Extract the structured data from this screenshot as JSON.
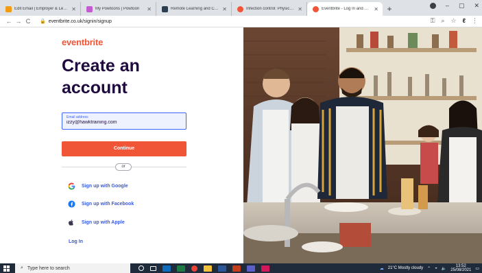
{
  "browser": {
    "tabs": [
      {
        "title": "Edit Email | Employer & Learner",
        "favicon_color": "#f39c12",
        "active": false
      },
      {
        "title": "My Powtoons | Powtoon",
        "favicon_color": "#c55bd1",
        "active": false
      },
      {
        "title": "Remote Learning and Communi",
        "favicon_color": "#2c3e50",
        "active": false
      },
      {
        "title": "Infection control: Physical care o",
        "favicon_color": "#f05537",
        "active": false
      },
      {
        "title": "Eventbrite - Log In and Sign In",
        "favicon_color": "#f05537",
        "active": true
      }
    ],
    "new_tab": "+",
    "url": "eventbrite.co.uk/signin/signup",
    "window_controls": {
      "minimize": "–",
      "maximize": "▢",
      "close": "✕"
    }
  },
  "page": {
    "brand": "eventbrite",
    "headline_line1": "Create an",
    "headline_line2": "account",
    "email": {
      "label": "Email address",
      "value": "izzy@hawktraining.com"
    },
    "continue_label": "Continue",
    "or_label": "or",
    "google_label": "Sign up with Google",
    "facebook_label": "Sign up with Facebook",
    "apple_label": "Sign up with Apple",
    "login_label": "Log In",
    "colors": {
      "brand": "#f05537",
      "heading": "#1e0a3c",
      "link": "#3659e3",
      "input_border": "#3d64ff"
    }
  },
  "taskbar": {
    "search_placeholder": "Type here to search",
    "weather": "21°C  Mostly cloudy",
    "time": "13:52",
    "date": "25/08/2021"
  }
}
